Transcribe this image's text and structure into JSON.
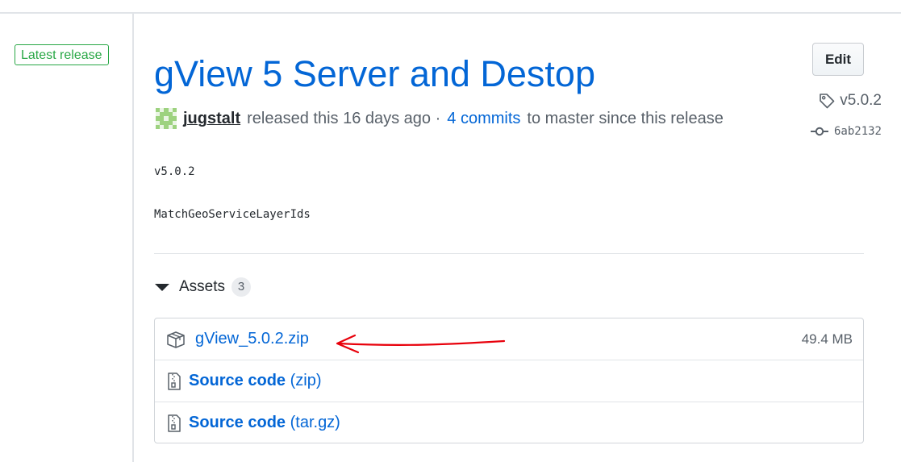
{
  "sidebar": {
    "badge": "Latest release",
    "tag": "v5.0.2",
    "commit": "6ab2132"
  },
  "release": {
    "title": "gView 5 Server and Destop",
    "edit_label": "Edit",
    "author": "jugstalt",
    "released_text": "released this 16 days ago ·",
    "commits_link": "4 commits",
    "commits_suffix": "to master since this release",
    "body": [
      "v5.0.2",
      "MatchGeoServiceLayerIds"
    ]
  },
  "assets": {
    "heading": "Assets",
    "count": "3",
    "items": [
      {
        "name": "gView_5.0.2.zip",
        "size": "49.4 MB",
        "icon": "package-icon"
      },
      {
        "name": "Source code",
        "suffix": "(zip)",
        "icon": "file-zip-icon"
      },
      {
        "name": "Source code",
        "suffix": "(tar.gz)",
        "icon": "file-zip-icon"
      }
    ]
  },
  "annotation": {
    "color": "#e8000b",
    "icon": "red-arrow-annotation"
  },
  "colors": {
    "link": "#0366d6",
    "badge": "#28a745",
    "muted": "#586069"
  }
}
